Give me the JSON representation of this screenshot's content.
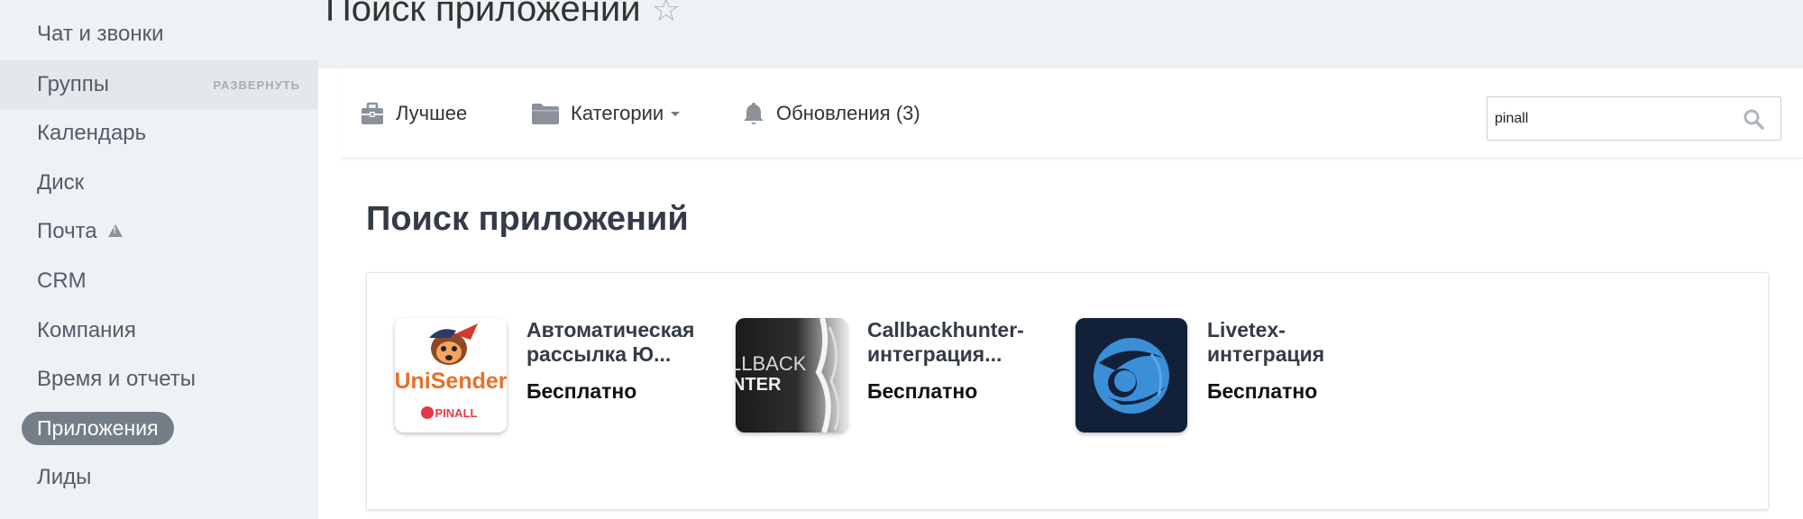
{
  "sidebar": {
    "items": [
      {
        "label": "Чат и звонки"
      },
      {
        "label": "Группы",
        "expand": "РАЗВЕРНУТЬ"
      },
      {
        "label": "Календарь"
      },
      {
        "label": "Диск"
      },
      {
        "label": "Почта"
      },
      {
        "label": "CRM"
      },
      {
        "label": "Компания"
      },
      {
        "label": "Время и отчеты"
      },
      {
        "label": "Приложения"
      },
      {
        "label": "Лиды"
      }
    ]
  },
  "header": {
    "title": "Поиск приложений"
  },
  "toolbar": {
    "best_label": "Лучшее",
    "categories_label": "Категории",
    "updates_label": "Обновления (3)"
  },
  "search": {
    "value": "pinall"
  },
  "main": {
    "section_title": "Поиск приложений"
  },
  "apps": [
    {
      "name": "Автоматическая рассылка Ю...",
      "price": "Бесплатно",
      "icon_text": "UniSender",
      "icon_sub": "PINALL"
    },
    {
      "name": "Callbackhunter-интеграция...",
      "price": "Бесплатно",
      "icon_text": "LLBACK",
      "icon_sub": "NTER"
    },
    {
      "name": "Livetex-интеграция",
      "price": "Бесплатно"
    }
  ],
  "colors": {
    "sidebar_bg": "#eef2f4",
    "active_pill": "#747e88",
    "unisender_orange": "#e8702a",
    "livetex_bg": "#13203a",
    "livetex_blue": "#3b8fd6"
  }
}
